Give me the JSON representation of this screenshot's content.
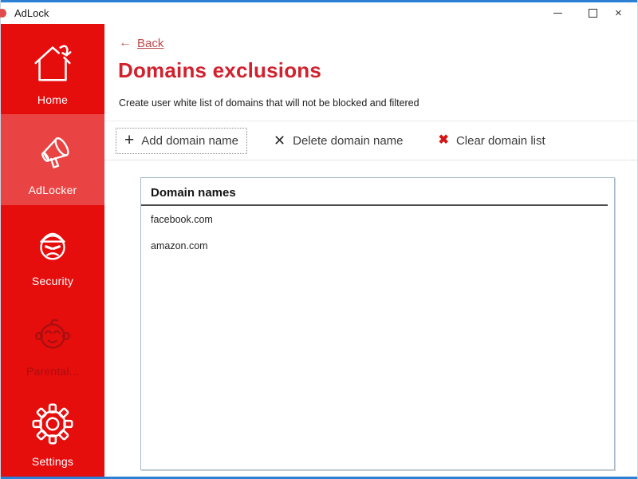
{
  "window": {
    "title": "AdLock",
    "controls": {
      "minimize_icon": "minimize-dash",
      "maximize_icon": "maximize-square",
      "close_glyph": "×"
    }
  },
  "colors": {
    "accent_blue_border": "#2b80d4",
    "sidebar_red": "#e60d0d",
    "sidebar_active_red": "#e94443",
    "sidebar_disabled_red": "#a81010",
    "title_red": "#d2212d",
    "back_link_red": "#c14a4a",
    "clear_x_red": "#d11717"
  },
  "sidebar": {
    "items": [
      {
        "label": "Home",
        "icon": "home-icon",
        "active": false,
        "disabled": false
      },
      {
        "label": "AdLocker",
        "icon": "megaphone-icon",
        "active": true,
        "disabled": false
      },
      {
        "label": "Security",
        "icon": "security-face-icon",
        "active": false,
        "disabled": false
      },
      {
        "label": "Parental...",
        "icon": "baby-face-icon",
        "active": false,
        "disabled": true
      },
      {
        "label": "Settings",
        "icon": "gear-icon",
        "active": false,
        "disabled": false
      }
    ]
  },
  "content": {
    "back": {
      "arrow": "←",
      "label": "Back"
    },
    "title": "Domains exclusions",
    "subtitle": "Create user white list of domains that will not be blocked and filtered",
    "toolbar": {
      "buttons": [
        {
          "icon": "plus-icon",
          "glyph": "+",
          "label": "Add domain name",
          "focused": true
        },
        {
          "icon": "x-icon",
          "glyph": "✕",
          "label": "Delete domain name",
          "focused": false
        },
        {
          "icon": "red-x-icon",
          "glyph": "✖",
          "label": "Clear domain list",
          "focused": false
        }
      ]
    },
    "list": {
      "header": "Domain names",
      "rows": [
        "facebook.com",
        "amazon.com"
      ]
    }
  }
}
